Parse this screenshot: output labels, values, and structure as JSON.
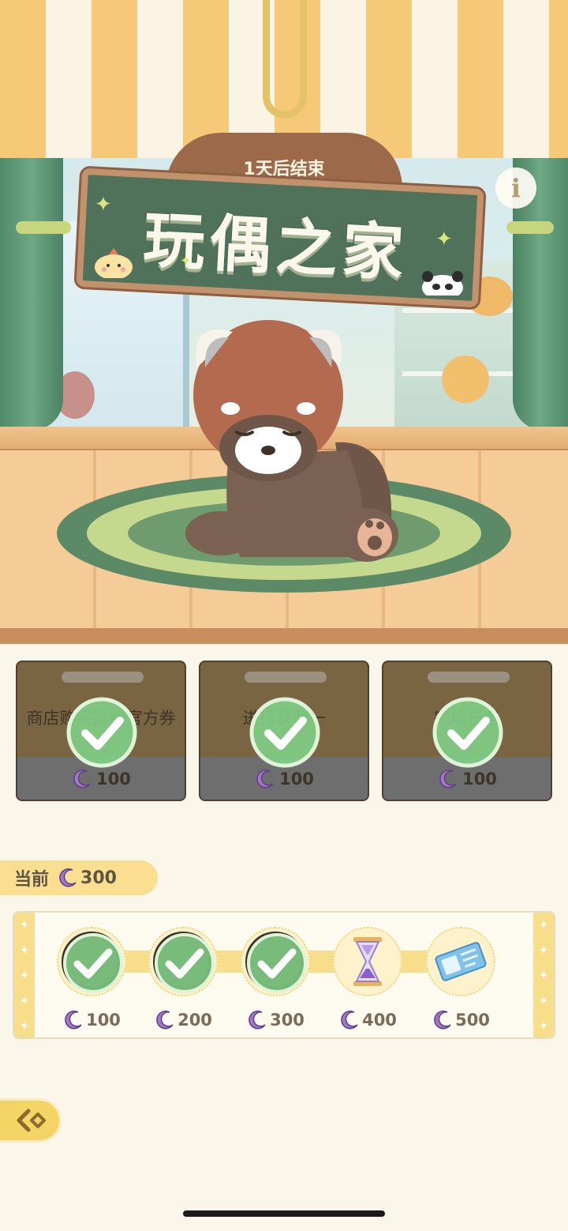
{
  "event": {
    "ends_in": "1天后结束",
    "title": "玩偶之家"
  },
  "tasks": [
    {
      "text": "商店购买高级官方券",
      "reward": "100",
      "completed": true
    },
    {
      "text": "进行获取一",
      "reward": "100",
      "completed": true
    },
    {
      "text": "完成任务",
      "reward": "100",
      "completed": true
    }
  ],
  "current": {
    "label": "当前",
    "value": "300"
  },
  "milestones": [
    {
      "value": "100",
      "state": "claimed",
      "icon": "check-icon"
    },
    {
      "value": "200",
      "state": "claimed",
      "icon": "check-icon"
    },
    {
      "value": "300",
      "state": "claimed",
      "icon": "check-icon"
    },
    {
      "value": "400",
      "state": "locked",
      "icon": "hourglass-icon"
    },
    {
      "value": "500",
      "state": "locked",
      "icon": "ticket-icon"
    }
  ],
  "colors": {
    "accent_yellow": "#f7de8a",
    "check_green": "#7fcf86",
    "moon_purple": "#a478c9",
    "sign_green": "#50715a"
  }
}
